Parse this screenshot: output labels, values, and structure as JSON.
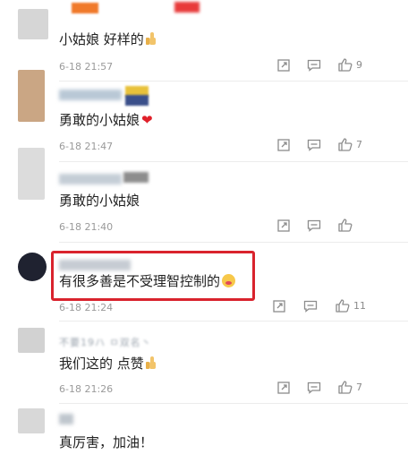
{
  "comments": [
    {
      "name": "",
      "text": "小姑娘  好样的",
      "emoji": "thumbs-up-emoji",
      "time": "6-18 21:57",
      "likes": "9"
    },
    {
      "name": "",
      "text": "勇敢的小姑娘",
      "emoji": "heart-emoji",
      "time": "6-18 21:47",
      "likes": "7"
    },
    {
      "name": "",
      "text": "勇敢的小姑娘",
      "emoji": "",
      "time": "6-18 21:40",
      "likes": ""
    },
    {
      "name": "",
      "text": "有很多善是不受理智控制的",
      "emoji": "face-emoji",
      "time": "6-18 21:24",
      "likes": "11"
    },
    {
      "name": "不要19ハ ㅁ双名丶",
      "text": "我们这的 点赞",
      "emoji": "thumbs-up-emoji",
      "time": "6-18 21:26",
      "likes": "7"
    },
    {
      "name": "",
      "text": "真厉害，加油！",
      "emoji": "",
      "time": "",
      "likes": ""
    }
  ],
  "icons": {
    "share": "share-icon",
    "comment": "comment-icon",
    "like": "like-icon"
  },
  "colors": {
    "highlight": "#d9232d",
    "meta": "#9a9a9a",
    "icon": "#8c8c8c"
  }
}
